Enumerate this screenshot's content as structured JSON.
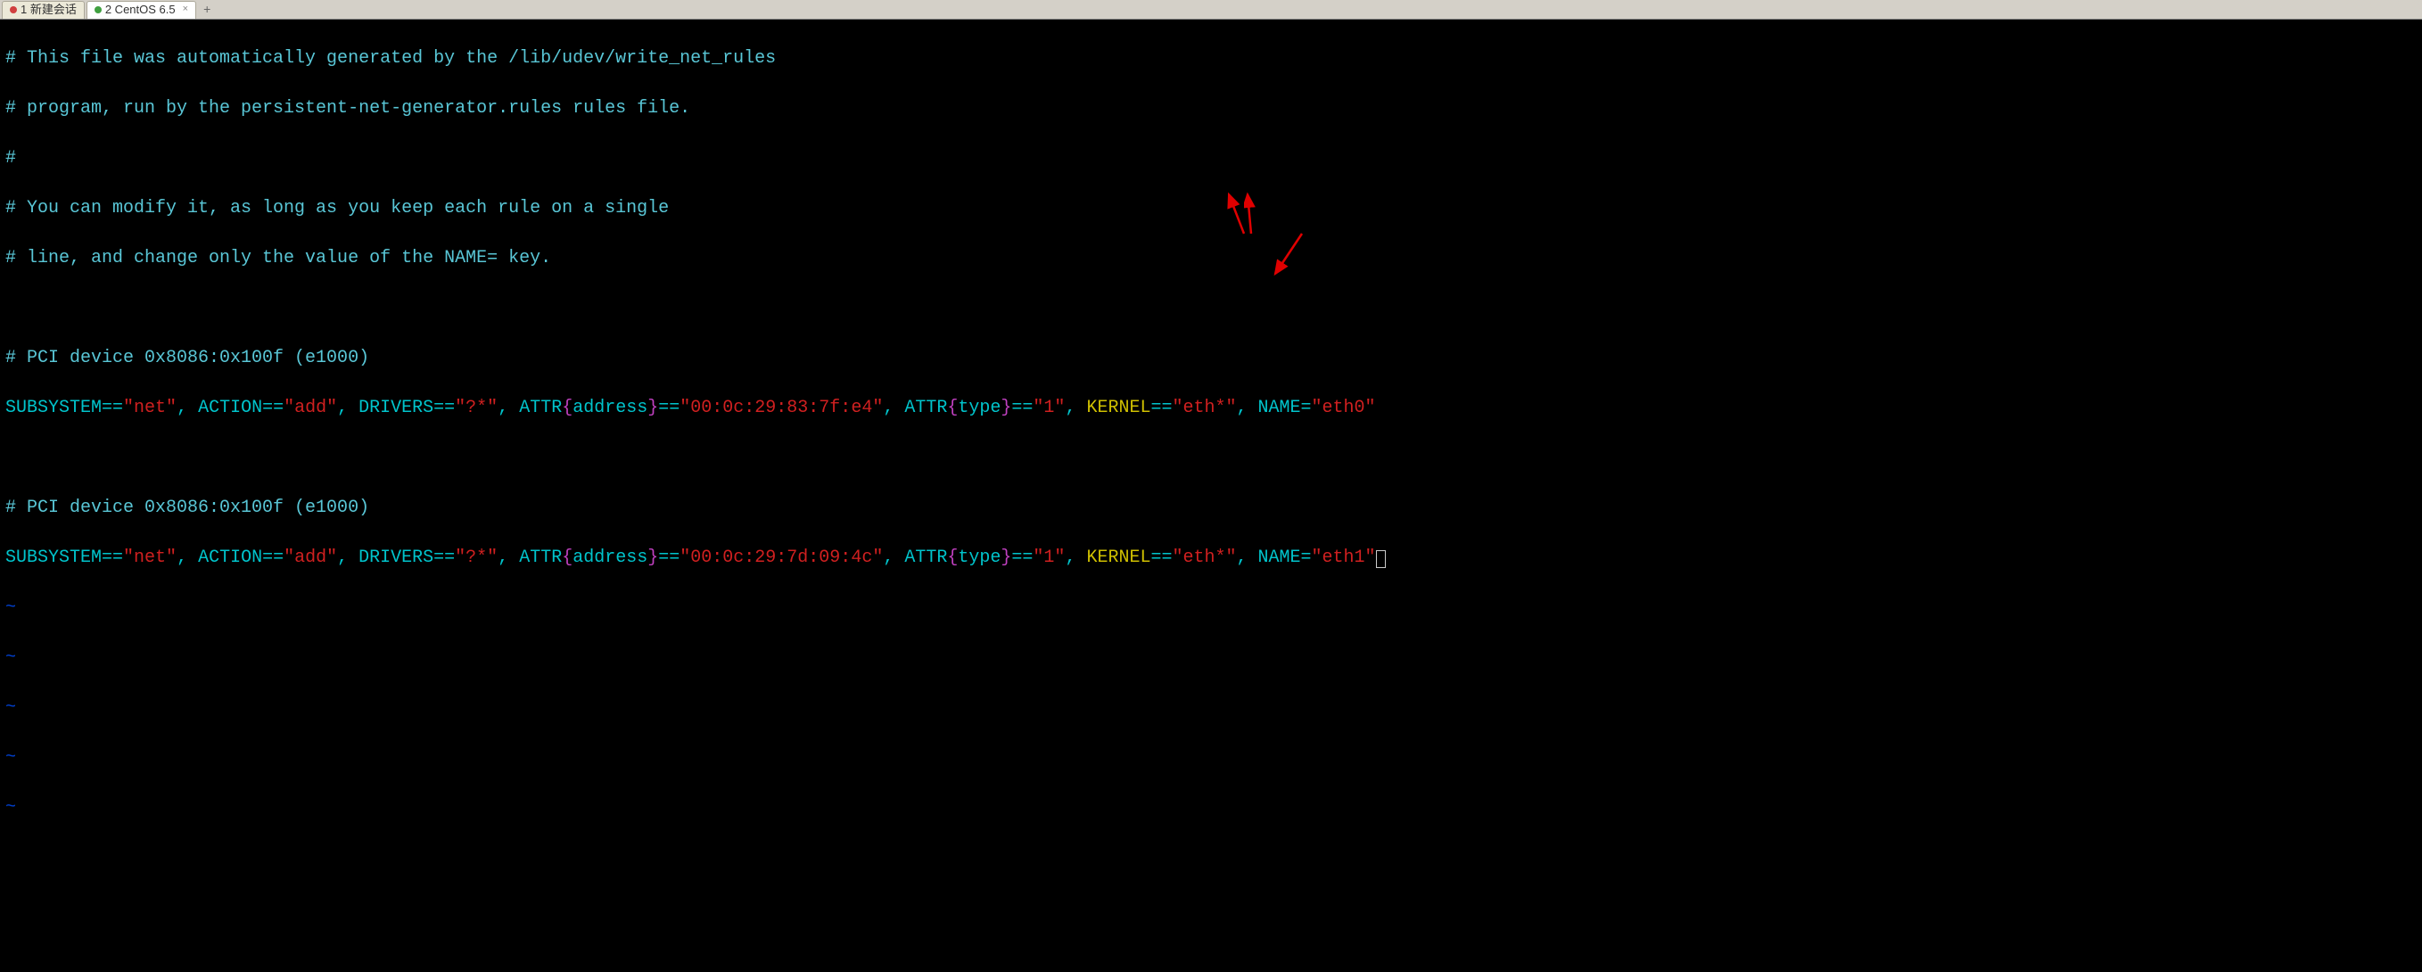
{
  "tabs": {
    "tab1_label": "1 新建会话",
    "tab2_label": "2 CentOS 6.5",
    "add_label": "+"
  },
  "comments": {
    "c1": "# This file was automatically generated by the /lib/udev/write_net_rules",
    "c2": "# program, run by the persistent-net-generator.rules rules file.",
    "c3": "#",
    "c4": "# You can modify it, as long as you keep each rule on a single",
    "c5": "# line, and change only the value of the NAME= key.",
    "c6": "# PCI device 0x8086:0x100f (e1000)",
    "c7": "# PCI device 0x8086:0x100f (e1000)"
  },
  "rule": {
    "subsystem": "SUBSYSTEM",
    "action": "ACTION",
    "drivers": "DRIVERS",
    "attr": "ATTR",
    "addr_label": "address",
    "type_label": "type",
    "kernel": "KERNEL",
    "name": "NAME",
    "eq2": "==",
    "eq1": "=",
    "comma": ", "
  },
  "values": {
    "net": "\"net\"",
    "add": "\"add\"",
    "qstar": "\"?*\"",
    "mac1": "\"00:0c:29:83:7f:e4\"",
    "mac2": "\"00:0c:29:7d:09:4c\"",
    "type1": "\"1\"",
    "ethstar": "\"eth*\"",
    "eth0": "\"eth0\"",
    "eth1": "\"eth1\""
  },
  "tilde": "~"
}
